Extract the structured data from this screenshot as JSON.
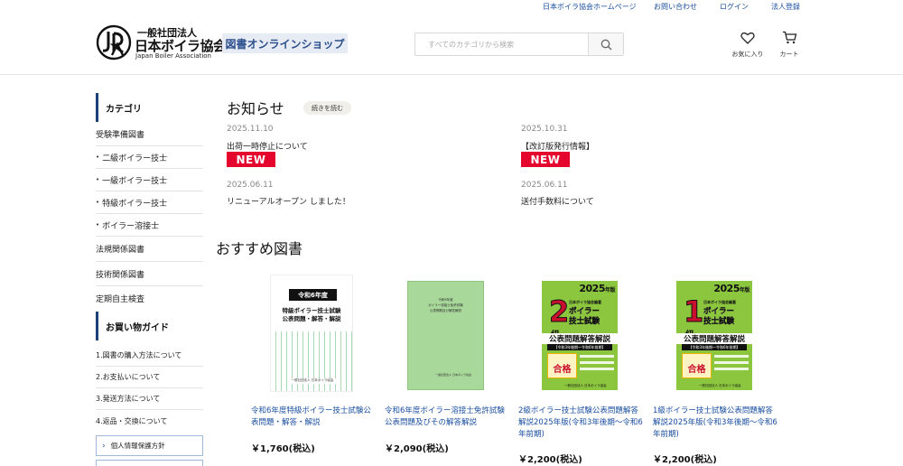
{
  "toplinks": {
    "home": "日本ボイラ協会ホームページ",
    "contact": "お問い合わせ",
    "login": "ログイン",
    "register": "法人登録"
  },
  "header": {
    "logo_line1": "一般社団法人",
    "logo_line2": "日本ボイラ協会",
    "logo_line3": "Japan Boiler Association",
    "shop_title": "図書オンラインショップ",
    "search_placeholder": "すべてのカテゴリから検索",
    "favorites": "お気に入り",
    "cart": "カート"
  },
  "sidebar": {
    "category_title": "カテゴリ",
    "categories": [
      {
        "label": "受験準備図書",
        "sub": false
      },
      {
        "label": "二級ボイラー技士",
        "sub": true
      },
      {
        "label": "一級ボイラー技士",
        "sub": true
      },
      {
        "label": "特級ボイラー技士",
        "sub": true
      },
      {
        "label": "ボイラー溶接士",
        "sub": true
      },
      {
        "label": "法規関係図書",
        "sub": false
      },
      {
        "label": "技術関係図書",
        "sub": false
      },
      {
        "label": "定期自主検査",
        "sub": false
      }
    ],
    "guide_title": "お買い物ガイド",
    "guide": [
      "1.図書の購入方法について",
      "2.お支払いについて",
      "3.発送方法について",
      "4.返品・交換について"
    ],
    "privacy": "個人情報保護方針"
  },
  "news": {
    "title": "お知らせ",
    "more": "続きを読む",
    "new_label": "NEW",
    "items": [
      {
        "date": "2025.11.10",
        "text": "出荷一時停止について",
        "is_new": true
      },
      {
        "date": "2025.10.31",
        "text": "【改訂版発行情報】",
        "is_new": true
      },
      {
        "date": "2025.06.11",
        "text": "リニューアルオープン しました！",
        "is_new": false
      },
      {
        "date": "2025.06.11",
        "text": "送付手数料について",
        "is_new": false
      }
    ]
  },
  "recommended": {
    "title": "おすすめ図書",
    "books": [
      {
        "name": "令和6年度特級ボイラー技士試験公表問題・解答・解説",
        "price": "￥1,760(税込)",
        "cover": {
          "year_label": "令和6年度",
          "line1": "特級ボイラー技士試験",
          "line2": "公表問題・解答・解説",
          "publisher": "一般社団法人 日本ボイラ協会"
        }
      },
      {
        "name": "令和6年度ボイラー溶接士免許試験公表問題及びその解答解説",
        "price": "￥2,090(税込)",
        "cover": {
          "line1": "令和6年度",
          "line2": "ボイラー溶接士免許試験",
          "line3": "公表問題及び解答解説",
          "publisher": "一般社団法人 日本ボイラ協会"
        }
      },
      {
        "name": "2級ボイラー技士試験公表問題解答解説2025年版(令和3年後期～令和6年前期)",
        "price": "￥2,200(税込)",
        "cover": {
          "year": "2025",
          "year_suffix": "年版",
          "grade": "2",
          "kyu": "級",
          "org": "日本ボイラ協会編著",
          "line1": "ボイラー",
          "line2": "技士試験",
          "line3": "公表問題解答解説",
          "range": "【令和3年後期～令和6年前期】",
          "seal": "合格",
          "publisher": "一般社団法人 日本ボイラ協会"
        }
      },
      {
        "name": "1級ボイラー技士試験公表問題解答解説2025年版(令和3年後期～令和6年前期)",
        "price": "￥2,200(税込)",
        "cover": {
          "year": "2025",
          "year_suffix": "年版",
          "grade": "1",
          "kyu": "級",
          "org": "日本ボイラ協会編著",
          "line1": "ボイラー",
          "line2": "技士試験",
          "line3": "公表問題解答解説",
          "range": "【令和3年後期～令和6年前期】",
          "seal": "合格",
          "publisher": "一般社団法人 日本ボイラ協会"
        }
      }
    ]
  },
  "colors": {
    "link": "#1a4fa0",
    "accent_bar": "#1c3f7a",
    "new_badge": "#e4062d",
    "cover_green": "#8cc63f"
  }
}
